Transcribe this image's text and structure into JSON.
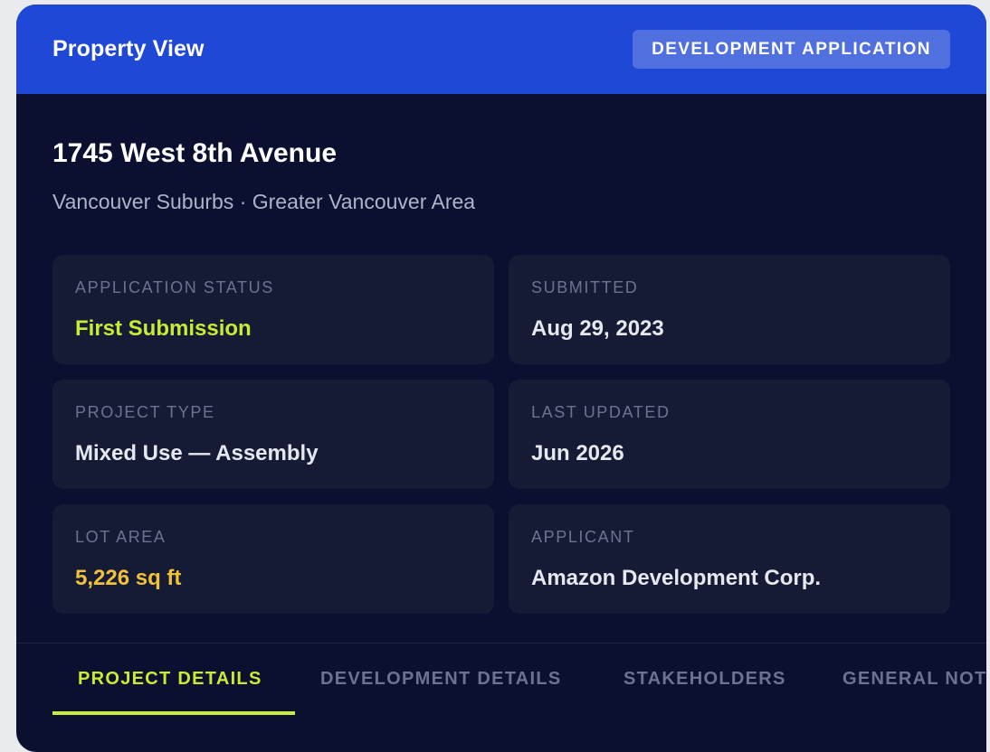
{
  "header": {
    "title": "Property View",
    "badge": "DEVELOPMENT APPLICATION"
  },
  "property": {
    "address": "1745 West 8th Avenue",
    "location": "Vancouver Suburbs · Greater Vancouver Area"
  },
  "details": [
    {
      "label": "APPLICATION STATUS",
      "value": "First Submission",
      "color": "#c6ec33"
    },
    {
      "label": "SUBMITTED",
      "value": "Aug 29, 2023"
    },
    {
      "label": "PROJECT TYPE",
      "value": "Mixed Use — Assembly"
    },
    {
      "label": "LAST UPDATED",
      "value": "Jun 2026"
    },
    {
      "label": "LOT AREA",
      "value": "5,226 sq ft",
      "color": "#f0c23a"
    },
    {
      "label": "APPLICANT",
      "value": "Amazon Development Corp."
    }
  ],
  "tabs": [
    {
      "label": "PROJECT DETAILS",
      "active": true
    },
    {
      "label": "DEVELOPMENT DETAILS",
      "active": false
    },
    {
      "label": "STAKEHOLDERS",
      "active": false
    },
    {
      "label": "GENERAL NOT",
      "active": false
    }
  ],
  "colors": {
    "header_bg": "#1f48d6",
    "card_bg": "#0b1030",
    "tile_bg": "#151b35",
    "accent_green": "#c6ec33",
    "accent_yellow": "#f0c23a"
  }
}
